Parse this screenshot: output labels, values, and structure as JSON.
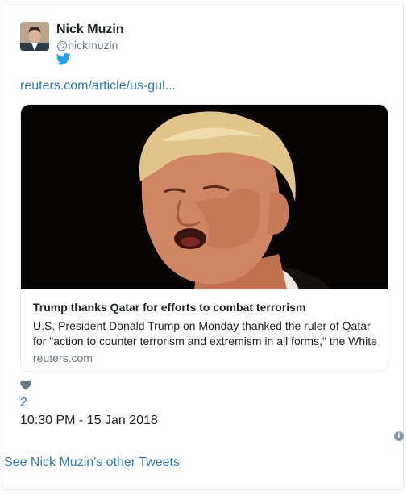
{
  "author": {
    "name": "Nick Muzin",
    "handle": "@nickmuzin"
  },
  "tweet": {
    "link_text": "reuters.com/article/us-gul...",
    "like_count": "2",
    "timestamp": "10:30 PM - 15 Jan 2018"
  },
  "card": {
    "title": "Trump thanks Qatar for efforts to combat terrorism",
    "description_line1": "U.S. President Donald Trump on Monday thanked the ruler of Qatar",
    "description_line2": "for \"action to counter terrorism and extremism in all forms,\" the White",
    "domain": "reuters.com"
  },
  "footer": {
    "see_more": "See Nick Muzin's other Tweets"
  },
  "icons": {
    "twitter": "twitter-bird-icon",
    "like": "heart-icon",
    "info": "info-icon"
  },
  "colors": {
    "link": "#2b7bb9",
    "secondary_text": "#697882",
    "border": "#e1e8ed",
    "icon_gray": "#8899a6"
  }
}
